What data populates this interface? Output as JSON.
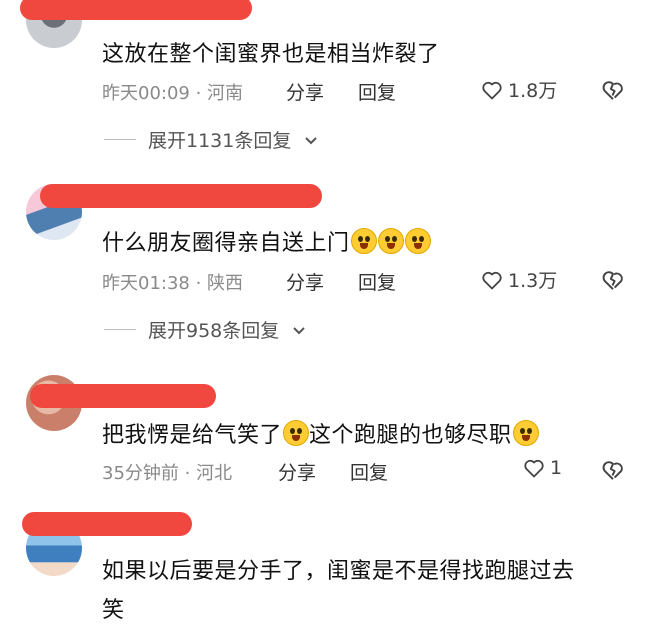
{
  "comments": [
    {
      "text": "这放在整个闺蜜界也是相当炸裂了",
      "time_location": "昨天00:09 · 河南",
      "share_label": "分享",
      "reply_label": "回复",
      "likes": "1.8万",
      "expand_label": "展开1131条回复"
    },
    {
      "text": "什么朋友圈得亲自送上门",
      "time_location": "昨天01:38 · 陕西",
      "share_label": "分享",
      "reply_label": "回复",
      "likes": "1.3万",
      "expand_label": "展开958条回复"
    },
    {
      "text_part1": "把我愣是给气笑了",
      "text_part2": "这个跑腿的也够尽职",
      "time_location": "35分钟前 · 河北",
      "share_label": "分享",
      "reply_label": "回复",
      "likes": "1"
    },
    {
      "text_line1": "如果以后要是分手了，闺蜜是不是得找跑腿过去",
      "text_line2": "笑"
    }
  ],
  "icons": {
    "like": "heart-outline-icon",
    "dislike": "broken-heart-icon",
    "expand": "chevron-down-icon"
  },
  "colors": {
    "redaction": "#f0483e",
    "meta": "#8a8a8a"
  }
}
